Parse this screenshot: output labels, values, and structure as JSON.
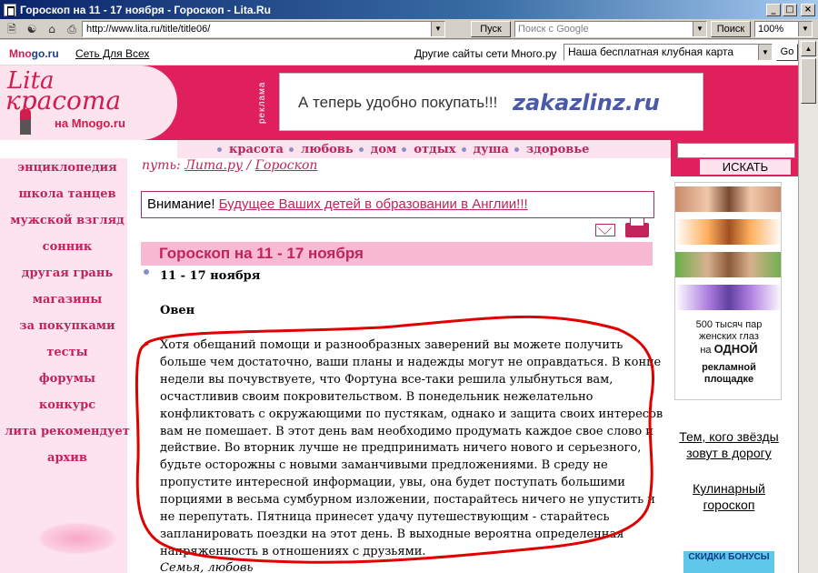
{
  "window": {
    "title": "Гороскоп на 11 - 17 ноября - Гороскоп - Lita.Ru",
    "minimize": "_",
    "maximize": "□",
    "close": "×"
  },
  "toolbar": {
    "address": "http://www.lita.ru/title/title06/",
    "go_label": "Пуск",
    "search_placeholder": "Поиск с Google",
    "search_label": "Поиск",
    "zoom": "100%"
  },
  "network": {
    "logo": "Mno",
    "logo_suffix": "go.ru",
    "set_link": "Сеть Для Всех",
    "other_sites": "Другие сайты сети Много.ру",
    "club_select": "Наша бесплатная клубная карта",
    "go": "Go"
  },
  "header": {
    "logo_lita": "Lita",
    "logo_krasota": "красота",
    "logo_na": "на Mnogo.ru",
    "reklama": "реклама",
    "banner_text": "А теперь удобно покупать!!!",
    "banner_brand": "zakazlinz.ru"
  },
  "nav": [
    "красота",
    "любовь",
    "дом",
    "отдых",
    "душа",
    "здоровье"
  ],
  "sidebar": [
    "энциклопедия",
    "школа танцев",
    "мужской взгляд",
    "сонник",
    "другая грань",
    "магазины",
    "за покупками",
    "тесты",
    "форумы",
    "конкурс",
    "лита рекомендует",
    "архив"
  ],
  "breadcrumb": {
    "prefix": "путь: ",
    "home": "Лита.ру",
    "sep": " / ",
    "section": "Гороскоп"
  },
  "notice": {
    "label": "Внимание! ",
    "link": "Будущее Ваших детей в образовании в Англии!!!"
  },
  "article": {
    "title": "Гороскоп на 11 - 17 ноября",
    "date": "11 - 17 ноября",
    "sign": "Овен",
    "body_lines": [
      "Хотя обещаний помощи и разнообразных заверений вы можете получить",
      "больше чем достаточно, ваши планы и надежды могут не оправдаться. В конце",
      "недели вы почувствуете, что Фортуна все-таки решила улыбнуться вам,",
      "осчастливив своим покровительством. В понедельник нежелательно",
      "конфликтовать с окружающими по пустякам, однако и защита своих интересов",
      "вам не помешает. В этот день вам необходимо продумать каждое свое слово и",
      "действие. Во вторник лучше не предпринимать ничего нового и серьезного,",
      "будьте осторожны с новыми заманчивыми предложениями. В среду не",
      "пропустите интересной информации, увы, она будет поступать большими",
      "порциями в весьма сумбурном изложении, постарайтесь ничего не упустить и",
      "не перепутать. Пятница принесет удачу путешествующим - старайтесь",
      "запланировать поездки на этот день. В выходные вероятна определенная",
      "напряженность в отношениях с друзьями."
    ],
    "next_sign": "Семья, любовь"
  },
  "right": {
    "find_label": "ИСКАТЬ",
    "ad_line1": "500 тысяч пар",
    "ad_line2": "женских глаз",
    "ad_line3_pre": "на ",
    "ad_line3_bold": "ОДНОЙ",
    "ad_line4": "рекламной",
    "ad_line5": "площадке",
    "link1": "Тем, кого звёзды зовут в дорогу",
    "link2": "Кулинарный гороскоп",
    "discount": "СКИДКИ БОНУСЫ"
  },
  "colors": {
    "brand_pink": "#e0205c",
    "link_crimson": "#c0245a",
    "pale_pink": "#fde3ee",
    "highlight_oval": "#e00000"
  }
}
